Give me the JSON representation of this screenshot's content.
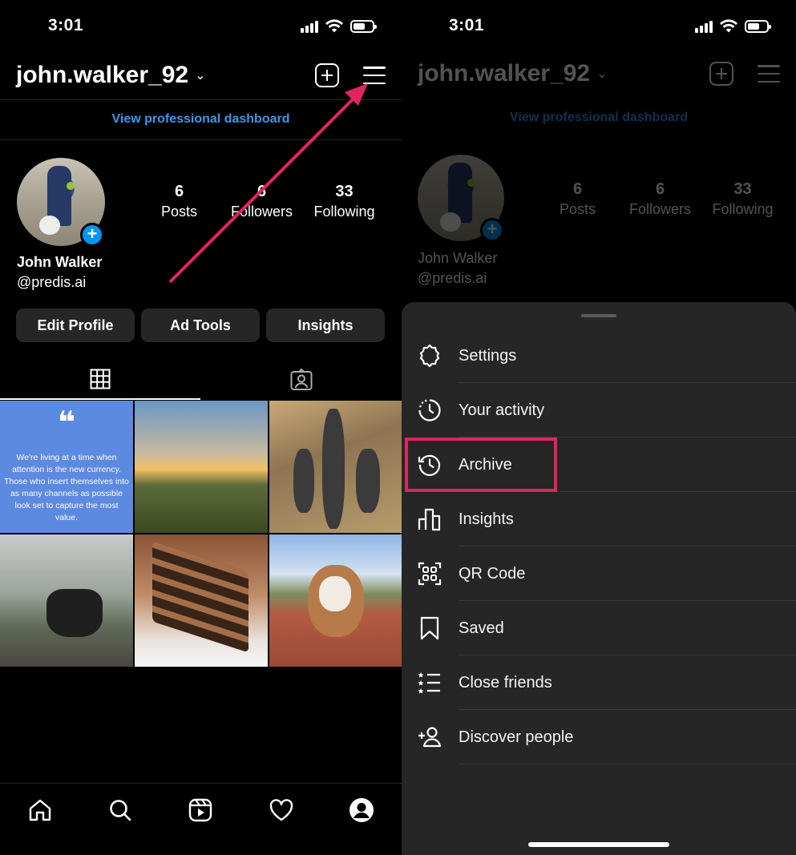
{
  "status": {
    "time": "3:01"
  },
  "profile": {
    "username": "john.walker_92",
    "dashboard_link": "View professional dashboard",
    "name": "John Walker",
    "handle": "@predis.ai",
    "stats": [
      {
        "num": "6",
        "label": "Posts"
      },
      {
        "num": "6",
        "label": "Followers"
      },
      {
        "num": "33",
        "label": "Following"
      }
    ],
    "buttons": {
      "edit": "Edit Profile",
      "adtools": "Ad Tools",
      "insights": "Insights"
    }
  },
  "quote_post": {
    "mark": "❝",
    "text": "We're living at a time when attention is the new currency. Those who insert themselves into as many channels as possible look set to capture the most value."
  },
  "menu": {
    "items": [
      {
        "label": "Settings",
        "icon": "settings-icon"
      },
      {
        "label": "Your activity",
        "icon": "activity-icon"
      },
      {
        "label": "Archive",
        "icon": "archive-icon"
      },
      {
        "label": "Insights",
        "icon": "insights-icon"
      },
      {
        "label": "QR Code",
        "icon": "qr-code-icon"
      },
      {
        "label": "Saved",
        "icon": "bookmark-icon"
      },
      {
        "label": "Close friends",
        "icon": "close-friends-icon"
      },
      {
        "label": "Discover people",
        "icon": "add-person-icon"
      }
    ]
  },
  "colors": {
    "accent_blue": "#3897f0",
    "annotation": "#e0245e",
    "sheet_bg": "#262626"
  }
}
